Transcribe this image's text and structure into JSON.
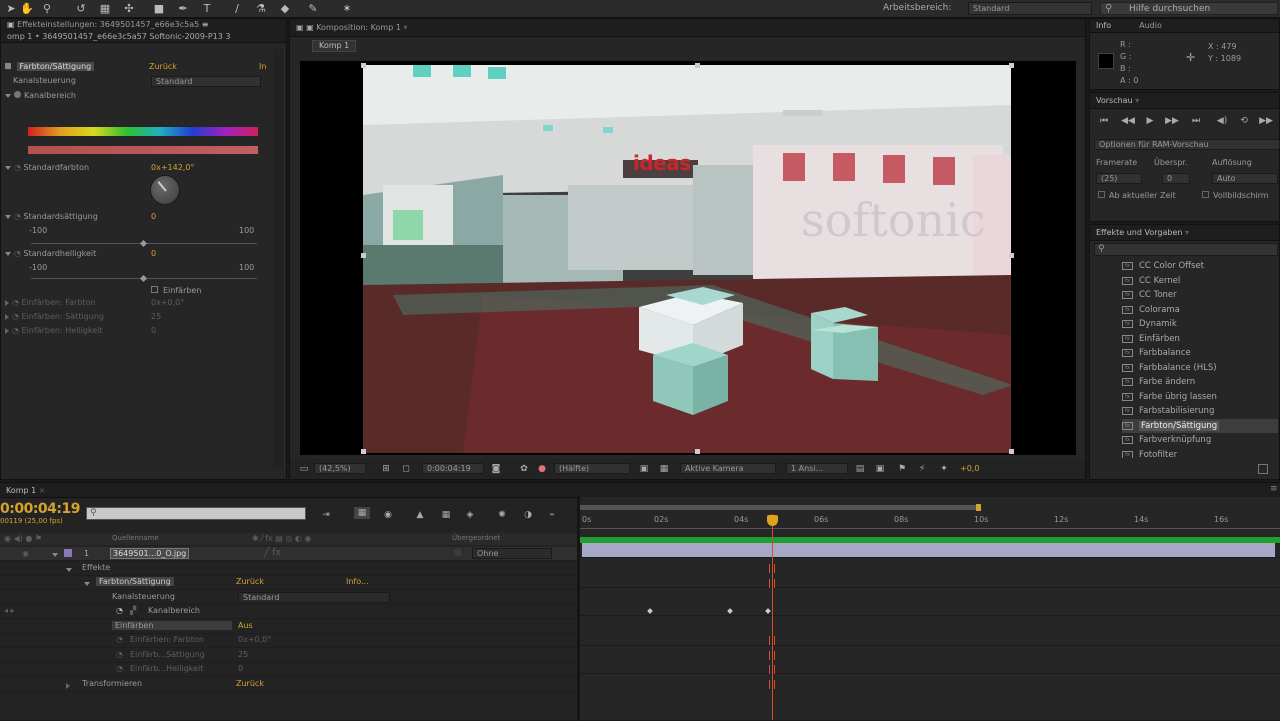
{
  "toolbar": {
    "workspace_label": "Arbeitsbereich:",
    "workspace_value": "Standard",
    "help_search_placeholder": "Hilfe durchsuchen"
  },
  "effects_panel": {
    "tab_title": "Effekteinstellungen: 3649501457_e66e3c5a5",
    "layer_path": "omp 1 • 3649501457_e66e3c5a57 Softonic-2009-P13 3",
    "effect_name": "Farbton/Sättigung",
    "effect_reset": "Zurück",
    "channel_control_label": "Kanalsteuerung",
    "channel_control_value": "Standard",
    "channel_range_label": "Kanalbereich",
    "master_hue_label": "Standardfarbton",
    "master_hue_value": "0x+142,0°",
    "master_sat_label": "Standardsättigung",
    "master_sat_value": "0",
    "master_sat_min": "-100",
    "master_sat_max": "100",
    "master_light_label": "Standardhelligkeit",
    "master_light_value": "0",
    "master_light_min": "-100",
    "master_light_max": "100",
    "colorize_label": "Einfärben",
    "colorize_hue_label": "Einfärben: Farbton",
    "colorize_hue_value": "0x+0,0°",
    "colorize_sat_label": "Einfärben: Sättigung",
    "colorize_sat_value": "25",
    "colorize_light_label": "Einfärben: Helligkeit",
    "colorize_light_value": "0"
  },
  "composition": {
    "tab_title": "Komposition: Komp 1",
    "comp_chip": "Komp 1",
    "sign_text": "ideas",
    "wall_text": "softonic",
    "zoom": "(42,5%)",
    "timecode": "0:00:04:19",
    "resolution": "(Hälfte)",
    "camera": "Aktive Kamera",
    "views": "1 Ansi...",
    "exposure": "+0,0"
  },
  "info": {
    "tab": "Info",
    "tab2": "Audio",
    "r_label": "R :",
    "g_label": "G :",
    "b_label": "B :",
    "a_label": "A : 0",
    "x_label": "X : 479",
    "y_label": "Y : 1089"
  },
  "preview": {
    "tab": "Vorschau",
    "options": "Optionen für RAM-Vorschau",
    "framerate_label": "Framerate",
    "skip_label": "Überspr.",
    "resolution_label": "Auflösung",
    "framerate_value": "(25)",
    "skip_value": "0",
    "resolution_value": "Auto",
    "from_current": "Ab aktueller Zeit",
    "fullscreen": "Vollbildschirm"
  },
  "effects_presets": {
    "tab": "Effekte und Vorgaben",
    "search_placeholder": "",
    "items": [
      "CC Color Offset",
      "CC Kernel",
      "CC Toner",
      "Colorama",
      "Dynamik",
      "Einfärben",
      "Farbbalance",
      "Farbbalance (HLS)",
      "Farbe ändern",
      "Farbe übrig lassen",
      "Farbstabilisierung",
      "Farbton/Sättigung",
      "Farbverknüpfung",
      "Fotofilter"
    ]
  },
  "timeline": {
    "tab": "Komp 1",
    "timecode": "0:00:04:19",
    "fps": "00119 (25,00 fps)",
    "col_source": "Quellenname",
    "col_parent": "Übergeordnet",
    "layer_index": "1",
    "layer_name": "3649501...0_O.jpg",
    "parent_value": "Ohne",
    "effects_label": "Effekte",
    "effect_name": "Farbton/Sättigung",
    "effect_reset": "Zurück",
    "effect_info": "Info...",
    "channel_control_label": "Kanalsteuerung",
    "channel_control_value": "Standard",
    "channel_range_label": "Kanalbereich",
    "colorize_label": "Einfärben",
    "colorize_value": "Aus",
    "colorize_hue_label": "Einfärben: Farbton",
    "colorize_hue_value": "0x+0,0°",
    "colorize_sat_label": "Einfärb...Sättigung",
    "colorize_sat_value": "25",
    "colorize_light_label": "Einfärb...Helligkeit",
    "colorize_light_value": "0",
    "transform_label": "Transformieren",
    "transform_reset": "Zurück",
    "ruler": [
      "0s",
      "02s",
      "04s",
      "06s",
      "08s",
      "10s",
      "12s",
      "14s",
      "16s"
    ]
  }
}
